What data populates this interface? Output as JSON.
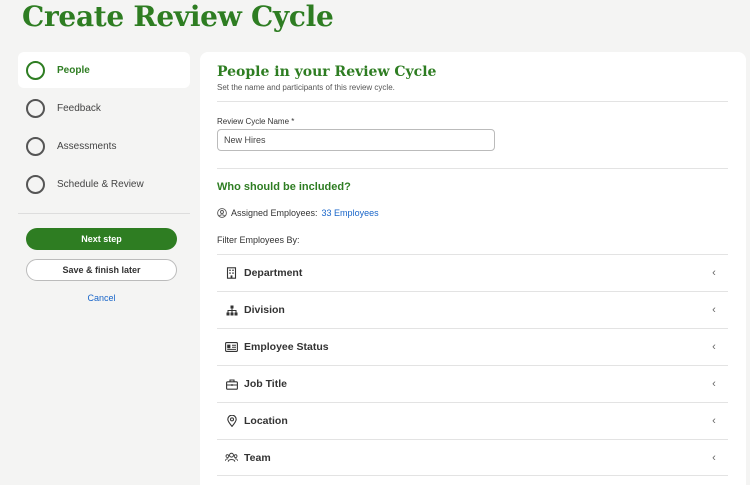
{
  "page_title": "Create Review Cycle",
  "sidebar": {
    "steps": [
      {
        "label": "People",
        "active": true
      },
      {
        "label": "Feedback",
        "active": false
      },
      {
        "label": "Assessments",
        "active": false
      },
      {
        "label": "Schedule & Review",
        "active": false
      }
    ],
    "next_label": "Next step",
    "save_label": "Save & finish later",
    "cancel_label": "Cancel"
  },
  "main": {
    "title": "People in your Review Cycle",
    "subtitle": "Set the name and participants of this review cycle.",
    "name_label": "Review Cycle Name *",
    "name_value": "New Hires",
    "section_title": "Who should be included?",
    "assigned_label": "Assigned Employees:",
    "assigned_count": "33 Employees",
    "filter_label": "Filter Employees By:",
    "filters": [
      {
        "label": "Department",
        "icon": "building-icon"
      },
      {
        "label": "Division",
        "icon": "org-chart-icon"
      },
      {
        "label": "Employee Status",
        "icon": "id-card-icon"
      },
      {
        "label": "Job Title",
        "icon": "briefcase-icon"
      },
      {
        "label": "Location",
        "icon": "map-pin-icon"
      },
      {
        "label": "Team",
        "icon": "team-icon"
      }
    ]
  },
  "colors": {
    "accent": "#2e7d22",
    "link": "#1a66c9"
  }
}
